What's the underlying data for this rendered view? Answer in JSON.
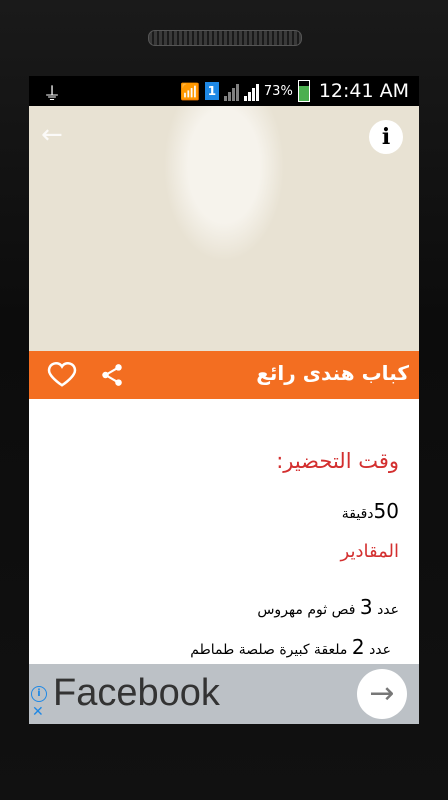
{
  "status_bar": {
    "battery": "73%",
    "time": "12:41 AM",
    "sim_slot": "1"
  },
  "recipe": {
    "title": "كباب هندى رائع",
    "prep_label": "وقت التحضير:",
    "prep_value_number": "50",
    "prep_value_unit": "دقيقة",
    "ingredients_label": "المقادير",
    "ingredients": [
      {
        "prefix": "عدد",
        "qty": "3",
        "text": "فص ثوم مهروس"
      },
      {
        "prefix": "عدد",
        "qty": "2",
        "text": "ملعقة كبيرة صلصة طماطم"
      }
    ]
  },
  "ad": {
    "text": "Facebook"
  },
  "colors": {
    "accent": "#f36e21",
    "heading_red": "#d32f2f"
  }
}
